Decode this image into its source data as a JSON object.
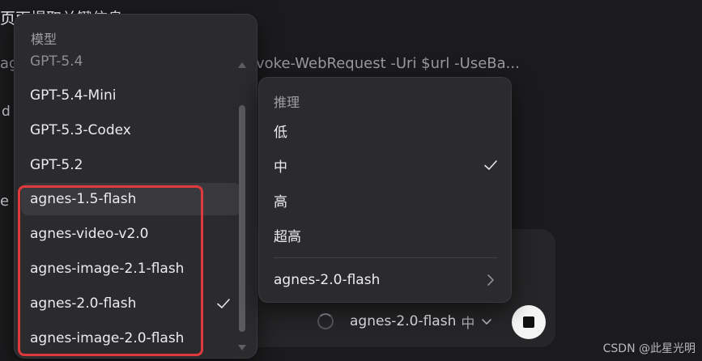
{
  "background": {
    "line1": "页面提取关键信息",
    "line2": "ag",
    "line2b": "voke-WebRequest -Uri $url -UseBa...",
    "line3": "d",
    "line4": "e"
  },
  "model_menu": {
    "header": "模型",
    "items": [
      {
        "label": "GPT-5.4",
        "state": "faded"
      },
      {
        "label": "GPT-5.4-Mini"
      },
      {
        "label": "GPT-5.3-Codex"
      },
      {
        "label": "GPT-5.2"
      },
      {
        "label": "agnes-1.5-flash",
        "state": "hover"
      },
      {
        "label": "agnes-video-v2.0"
      },
      {
        "label": "agnes-image-2.1-flash"
      },
      {
        "label": "agnes-2.0-flash",
        "selected": true
      },
      {
        "label": "agnes-image-2.0-flash"
      }
    ]
  },
  "reason_menu": {
    "header": "推理",
    "items": [
      {
        "label": "低"
      },
      {
        "label": "中",
        "selected": true
      },
      {
        "label": "高"
      },
      {
        "label": "超高"
      }
    ],
    "model_link": "agnes-2.0-flash"
  },
  "composer": {
    "model": "agnes-2.0-flash",
    "effort": "中"
  },
  "watermark": "CSDN @此星光明",
  "colors": {
    "highlight": "#e0393b",
    "menu_bg": "#2b2b2e",
    "page_bg": "#1b1b1d"
  }
}
